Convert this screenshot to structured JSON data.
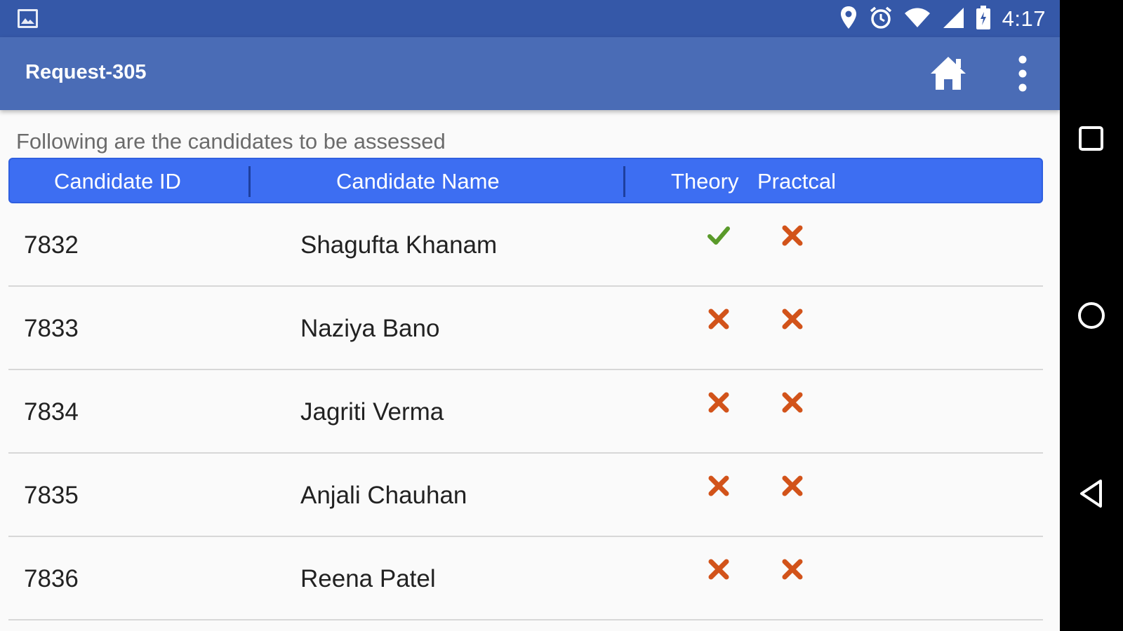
{
  "status_bar": {
    "time": "4:17",
    "icons": [
      "gallery-icon",
      "location-icon",
      "alarm-icon",
      "wifi-icon",
      "signal-icon",
      "battery-charging-icon"
    ]
  },
  "app_bar": {
    "title": "Request-305",
    "actions": [
      "home-icon",
      "more-vert-icon"
    ]
  },
  "subtitle": "Following are the candidates to be assessed",
  "table": {
    "headers": [
      "Candidate ID",
      "Candidate Name",
      "Theory",
      "Practcal"
    ],
    "rows": [
      {
        "id": "7832",
        "name": "Shagufta Khanam",
        "theory": "check",
        "practical": "cross"
      },
      {
        "id": "7833",
        "name": "Naziya Bano",
        "theory": "cross",
        "practical": "cross"
      },
      {
        "id": "7834",
        "name": "Jagriti Verma",
        "theory": "cross",
        "practical": "cross"
      },
      {
        "id": "7835",
        "name": "Anjali Chauhan",
        "theory": "cross",
        "practical": "cross"
      },
      {
        "id": "7836",
        "name": "Reena Patel",
        "theory": "cross",
        "practical": "cross"
      }
    ]
  },
  "colors": {
    "status_bar": "#3558a8",
    "app_bar": "#4a6cb6",
    "header": "#3d6ef2",
    "check": "#5a9a2a",
    "cross": "#d2531a"
  },
  "nav_bar": {
    "buttons": [
      "recents-icon",
      "home-circle-icon",
      "back-icon"
    ]
  }
}
